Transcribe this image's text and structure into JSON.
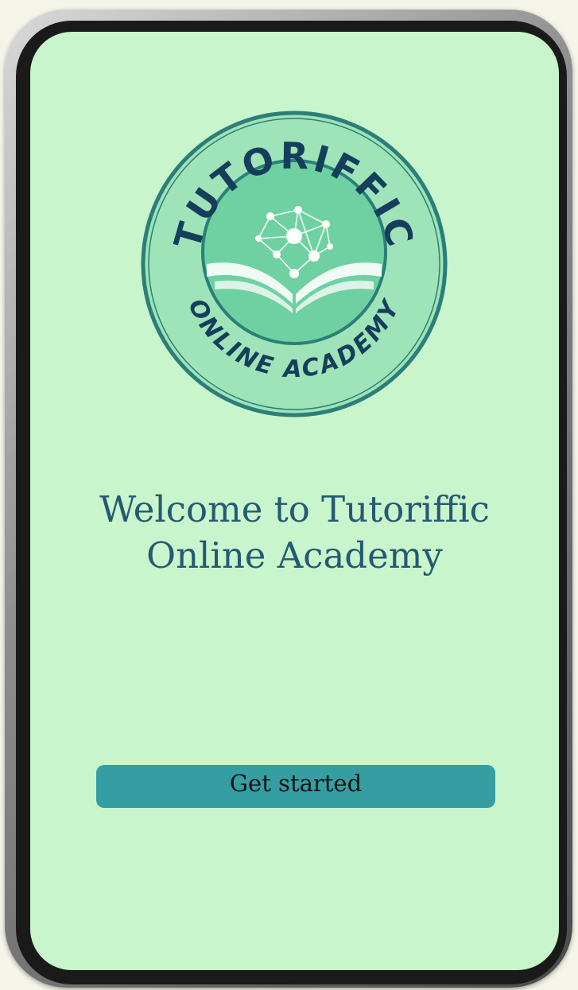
{
  "logo": {
    "text_top": "TUTORIFFIC",
    "text_bottom": "ONLINE ACADEMY"
  },
  "welcome": {
    "line1": "Welcome to Tutoriffic",
    "line2": "Online Academy"
  },
  "actions": {
    "get_started_label": "Get started"
  },
  "colors": {
    "background": "#c8f5cb",
    "primary_text": "#245a73",
    "button": "#349ea3",
    "logo_ring": "#2b7f78",
    "logo_inner": "#6fd1a1",
    "logo_text": "#153e5c"
  },
  "icons": [
    "network-brain-icon",
    "open-book-icon"
  ]
}
